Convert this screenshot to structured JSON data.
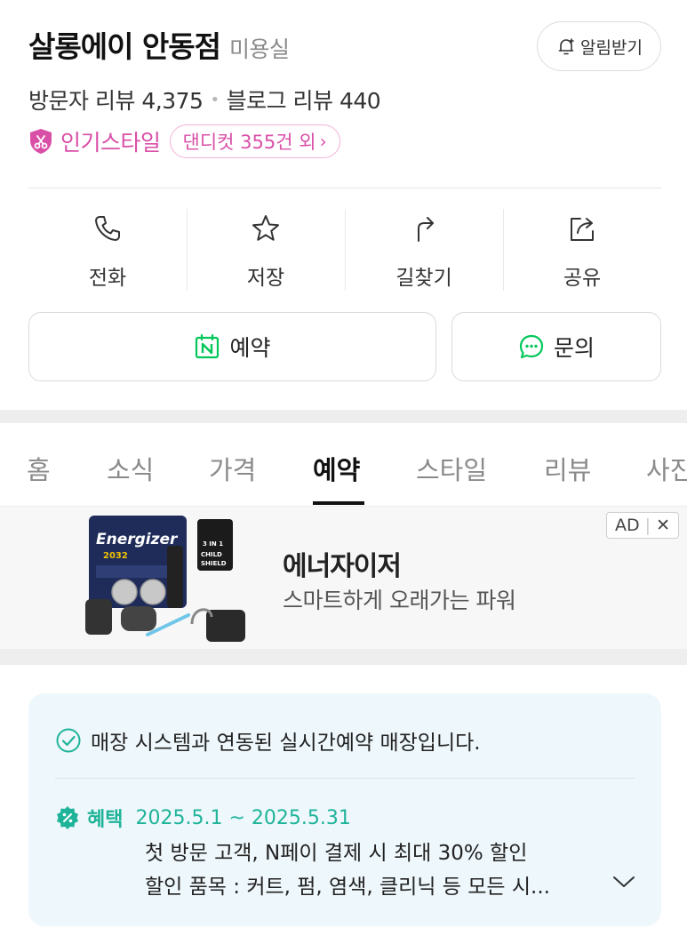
{
  "shop": {
    "name": "살롱에이 안동점",
    "category": "미용실",
    "alarm_label": "알림받기"
  },
  "reviews": {
    "visitor": "방문자 리뷰 4,375",
    "separator": "•",
    "blog": "블로그 리뷰 440"
  },
  "popular": {
    "label": "인기스타일",
    "chip": "댄디컷 355건 외",
    "chip_arrow": "›"
  },
  "actions": [
    {
      "label": "전화",
      "icon": "phone-icon"
    },
    {
      "label": "저장",
      "icon": "star-icon"
    },
    {
      "label": "길찾기",
      "icon": "directions-icon"
    },
    {
      "label": "공유",
      "icon": "share-icon"
    }
  ],
  "buttons": {
    "reserve": "예약",
    "inquiry": "문의"
  },
  "tabs": [
    "홈",
    "소식",
    "가격",
    "예약",
    "스타일",
    "리뷰",
    "사진"
  ],
  "active_tab": "예약",
  "ad": {
    "badge": "AD",
    "close": "✕",
    "title": "에너자이저",
    "subtitle": "스마트하게 오래가는 파워",
    "product_text": "Energizer",
    "product_model": "2032",
    "shield_text": "3 IN 1 CHILD SHIELD"
  },
  "info": {
    "realtime": "매장 시스템과 연동된 실시간예약 매장입니다.",
    "benefit_label": "혜택",
    "benefit_date": "2025.5.1 ~ 2025.5.31",
    "benefit_desc1": "첫 방문 고객, N페이 결제 시 최대 30% 할인",
    "benefit_desc2": "할인 품목 : 커트, 펌, 염색, 클리닉 등 모든 시..."
  },
  "colors": {
    "accent_pink": "#d94fa7",
    "naver_green": "#03c75a",
    "benefit_teal": "#1fb49a",
    "info_bg": "#eef7fb"
  }
}
